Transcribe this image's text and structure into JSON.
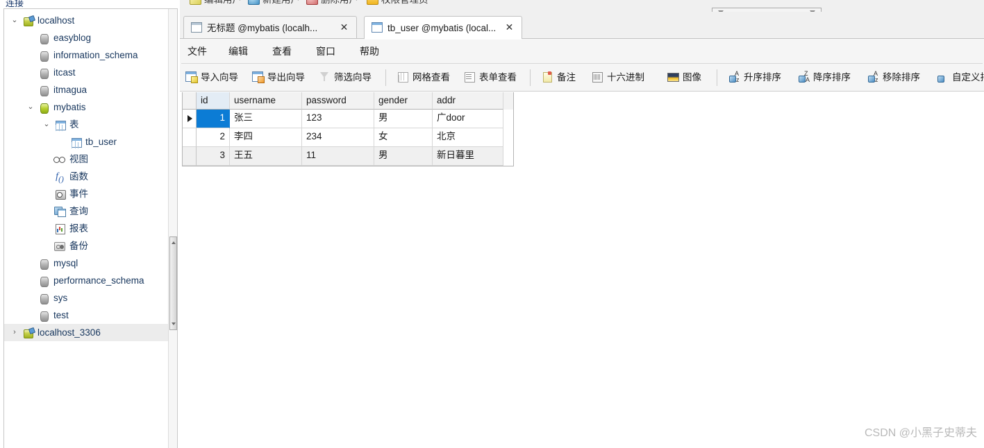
{
  "sidebar": {
    "section_label": "连接",
    "tree": [
      {
        "label": "localhost",
        "icon": "server-icon",
        "depth": 0,
        "twisty": "down",
        "selected": false
      },
      {
        "label": "easyblog",
        "icon": "database-icon",
        "depth": 1,
        "twisty": "",
        "selected": false
      },
      {
        "label": "information_schema",
        "icon": "database-icon",
        "depth": 1,
        "twisty": "",
        "selected": false
      },
      {
        "label": "itcast",
        "icon": "database-icon",
        "depth": 1,
        "twisty": "",
        "selected": false
      },
      {
        "label": "itmagua",
        "icon": "database-icon",
        "depth": 1,
        "twisty": "",
        "selected": false
      },
      {
        "label": "mybatis",
        "icon": "database-active-icon",
        "depth": 1,
        "twisty": "down",
        "selected": false
      },
      {
        "label": "表",
        "icon": "table-folder-icon",
        "depth": 2,
        "twisty": "down",
        "selected": false
      },
      {
        "label": "tb_user",
        "icon": "table-icon",
        "depth": 3,
        "twisty": "",
        "selected": false
      },
      {
        "label": "视图",
        "icon": "view-icon",
        "depth": 2,
        "twisty": "",
        "selected": false
      },
      {
        "label": "函数",
        "icon": "function-icon",
        "depth": 2,
        "twisty": "",
        "selected": false
      },
      {
        "label": "事件",
        "icon": "event-icon",
        "depth": 2,
        "twisty": "",
        "selected": false
      },
      {
        "label": "查询",
        "icon": "query-icon",
        "depth": 2,
        "twisty": "",
        "selected": false
      },
      {
        "label": "报表",
        "icon": "report-icon",
        "depth": 2,
        "twisty": "",
        "selected": false
      },
      {
        "label": "备份",
        "icon": "backup-icon",
        "depth": 2,
        "twisty": "",
        "selected": false
      },
      {
        "label": "mysql",
        "icon": "database-icon",
        "depth": 1,
        "twisty": "",
        "selected": false
      },
      {
        "label": "performance_schema",
        "icon": "database-icon",
        "depth": 1,
        "twisty": "",
        "selected": false
      },
      {
        "label": "sys",
        "icon": "database-icon",
        "depth": 1,
        "twisty": "",
        "selected": false
      },
      {
        "label": "test",
        "icon": "database-icon",
        "depth": 1,
        "twisty": "",
        "selected": false
      },
      {
        "label": "localhost_3306",
        "icon": "server-icon",
        "depth": 0,
        "twisty": "right",
        "selected": true
      }
    ]
  },
  "top_toolbar": {
    "items": [
      {
        "label": "编辑用户",
        "icon": "edit-user-icon"
      },
      {
        "label": "新建用户",
        "icon": "new-user-icon"
      },
      {
        "label": "删除用户",
        "icon": "delete-user-icon"
      },
      {
        "label": "权限管理员",
        "icon": "permission-manager-icon"
      }
    ]
  },
  "tabs": [
    {
      "title": "无标题 @mybatis (localh...",
      "icon": "query-tab-icon",
      "close": "✕",
      "active": false
    },
    {
      "title": "tb_user @mybatis (local...",
      "icon": "table-tab-icon",
      "close": "✕",
      "active": true
    }
  ],
  "menubar": {
    "items": [
      {
        "label": "文件"
      },
      {
        "label": "编辑"
      },
      {
        "label": "查看"
      },
      {
        "label": "窗口"
      },
      {
        "label": "帮助"
      }
    ]
  },
  "toolbar": {
    "items": [
      {
        "label": "导入向导",
        "icon": "import-wizard-icon"
      },
      {
        "label": "导出向导",
        "icon": "export-wizard-icon"
      },
      {
        "label": "筛选向导",
        "icon": "filter-wizard-icon"
      },
      {
        "label": "网格查看",
        "icon": "grid-view-icon"
      },
      {
        "label": "表单查看",
        "icon": "form-view-icon"
      },
      {
        "label": "备注",
        "icon": "memo-icon"
      },
      {
        "label": "十六进制",
        "icon": "hex-icon"
      },
      {
        "label": "图像",
        "icon": "image-icon"
      },
      {
        "label": "升序排序",
        "icon": "sort-asc-icon"
      },
      {
        "label": "降序排序",
        "icon": "sort-desc-icon"
      },
      {
        "label": "移除排序",
        "icon": "sort-remove-icon"
      },
      {
        "label": "自定义排序",
        "icon": "custom-sort-icon"
      }
    ]
  },
  "grid": {
    "columns": [
      "id",
      "username",
      "password",
      "gender",
      "addr"
    ],
    "rows": [
      {
        "id": "1",
        "username": "张三",
        "password": "123",
        "gender": "男",
        "addr": "广door"
      },
      {
        "id": "2",
        "username": "李四",
        "password": "234",
        "gender": "女",
        "addr": "北京"
      },
      {
        "id": "3",
        "username": "王五",
        "password": "11",
        "gender": "男",
        "addr": "新日暮里"
      }
    ],
    "selected_row": 0,
    "selected_column": "id",
    "row_marker": "▶"
  },
  "watermark": {
    "text": "CSDN @小黑子史蒂夫"
  },
  "colors": {
    "selection_blue": "#0c7cd5",
    "toolbar_bg": "#f5f5f5",
    "panel_bg": "#f0f0f0",
    "tree_text": "#17365d",
    "alt_row": "#f0f0f0",
    "watermark": "#b9b9b9"
  }
}
